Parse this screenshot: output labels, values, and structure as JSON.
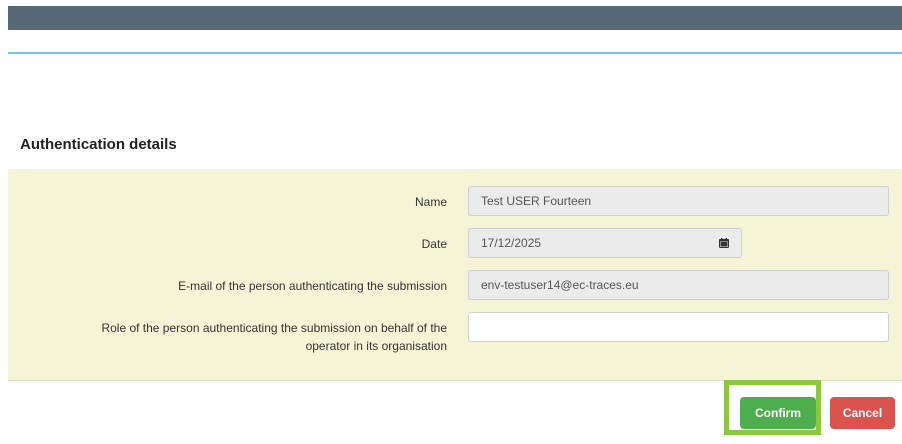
{
  "section": {
    "title": "Authentication details"
  },
  "fields": {
    "name": {
      "label": "Name",
      "value": "Test USER Fourteen"
    },
    "date": {
      "label": "Date",
      "value": "17/12/2025"
    },
    "email": {
      "label": "E-mail of the person authenticating the submission",
      "value": "env-testuser14@ec-traces.eu"
    },
    "role": {
      "label_line1": "Role of the person authenticating the submission on behalf of the",
      "label_line2": "operator in its organisation",
      "value": ""
    }
  },
  "buttons": {
    "confirm": "Confirm",
    "cancel": "Cancel"
  },
  "colors": {
    "header_bar": "#566975",
    "divider": "#79c2e6",
    "panel_bg": "#f5f4d6",
    "confirm_bg": "#4cae4c",
    "cancel_bg": "#d9534f",
    "highlight_border": "#8dc63f"
  },
  "icons": {
    "date_picker": "calendar-icon"
  }
}
